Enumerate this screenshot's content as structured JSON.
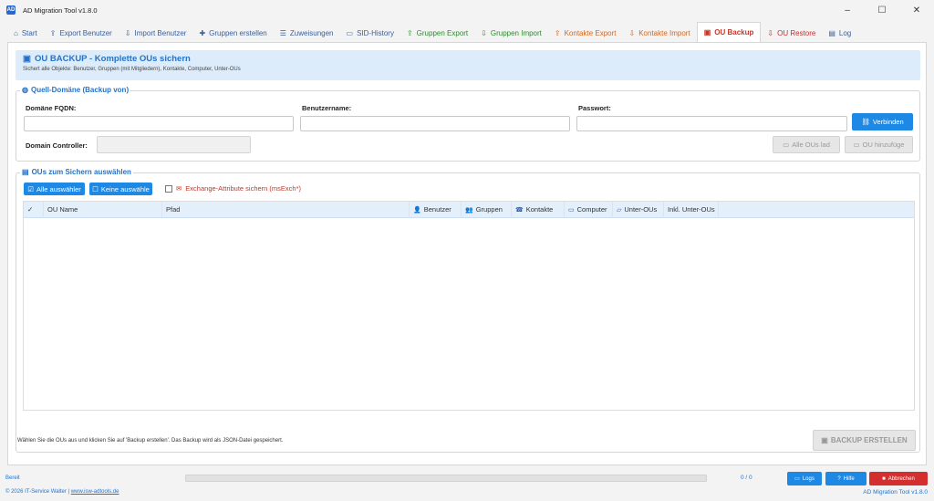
{
  "window": {
    "title": "AD Migration Tool v1.8.0",
    "controls": [
      "–",
      "☐",
      "✕"
    ]
  },
  "tabs": [
    {
      "label": "Start",
      "icon": "home-icon",
      "glyph": "⌂",
      "color": "blue",
      "active": false
    },
    {
      "label": "Export Benutzer",
      "icon": "export-icon",
      "glyph": "⇪",
      "color": "blue",
      "active": false
    },
    {
      "label": "Import Benutzer",
      "icon": "import-icon",
      "glyph": "⇩",
      "color": "blue",
      "active": false
    },
    {
      "label": "Gruppen erstellen",
      "icon": "plus-icon",
      "glyph": "✚",
      "color": "blue",
      "active": false
    },
    {
      "label": "Zuweisungen",
      "icon": "list-icon",
      "glyph": "☰",
      "color": "blue",
      "active": false
    },
    {
      "label": "SID-History",
      "icon": "id-card-icon",
      "glyph": "▭",
      "color": "blue",
      "active": false
    },
    {
      "label": "Gruppen Export",
      "icon": "export-icon",
      "glyph": "⇪",
      "color": "green",
      "active": false
    },
    {
      "label": "Gruppen Import",
      "icon": "import-icon",
      "glyph": "⇩",
      "color": "green",
      "active": false
    },
    {
      "label": "Kontakte Export",
      "icon": "export-icon",
      "glyph": "⇪",
      "color": "orange",
      "active": false
    },
    {
      "label": "Kontakte Import",
      "icon": "import-icon",
      "glyph": "⇩",
      "color": "orange",
      "active": false
    },
    {
      "label": "OU Backup",
      "icon": "save-icon",
      "glyph": "▣",
      "color": "red",
      "active": true
    },
    {
      "label": "OU Restore",
      "icon": "restore-icon",
      "glyph": "⇩",
      "color": "red",
      "active": false
    },
    {
      "label": "Log",
      "icon": "document-icon",
      "glyph": "▤",
      "color": "blue",
      "active": false
    }
  ],
  "banner": {
    "title": "OU BACKUP - Komplette OUs sichern",
    "subtitle": "Sichert alle Objekte: Benutzer, Gruppen (mit Mitgliedern), Kontakte, Computer, Unter-OUs"
  },
  "source": {
    "legend": "Quell-Domäne (Backup von)",
    "fqdn_label": "Domäne FQDN:",
    "fqdn_value": "",
    "user_label": "Benutzername:",
    "user_value": "",
    "pass_label": "Passwort:",
    "pass_value": "",
    "dc_label": "Domain Controller:",
    "dc_value": "",
    "connect_button": "Verbinden",
    "load_ous_button": "Alle OUs lad",
    "add_ou_button": "OU hinzufüge"
  },
  "select": {
    "legend": "OUs zum Sichern auswählen",
    "select_all_button": "Alle auswähler",
    "select_none_button": "Keine auswähle",
    "exchange_checkbox_label": "Exchange-Attribute sichern (msExch*)",
    "exchange_checked": false
  },
  "grid": {
    "columns": [
      {
        "label": "✓",
        "icon": null
      },
      {
        "label": "OU Name",
        "icon": null
      },
      {
        "label": "Pfad",
        "icon": null
      },
      {
        "label": "Benutzer",
        "icon": "user-icon"
      },
      {
        "label": "Gruppen",
        "icon": "group-icon"
      },
      {
        "label": "Kontakte",
        "icon": "contact-icon"
      },
      {
        "label": "Computer",
        "icon": "computer-icon"
      },
      {
        "label": "Unter-OUs",
        "icon": "folder-icon"
      },
      {
        "label": "Inkl. Unter-OUs",
        "icon": null
      }
    ],
    "rows": []
  },
  "info_text": "Wählen Sie die OUs aus und klicken Sie auf 'Backup erstellen'. Das Backup wird als JSON-Datei gespeichert.",
  "backup_button": "BACKUP ERSTELLEN",
  "status": {
    "text": "Bereit",
    "progress": 0,
    "count": "0 / 0",
    "logs_button": "Logs",
    "help_button": "Hilfe",
    "cancel_button": "Abbrechen",
    "copyright": "© 2026 IT-Service Walter |",
    "website": "www.isw-adtools.de",
    "version": "AD Migration Tool v1.8.0"
  },
  "colors": {
    "accent": "#1e88e5",
    "heading": "#2573c9",
    "active_tab": "#c0392b",
    "danger": "#d32f2f",
    "banner_bg": "#dcecfb",
    "grid_header_bg": "#e3effb"
  }
}
